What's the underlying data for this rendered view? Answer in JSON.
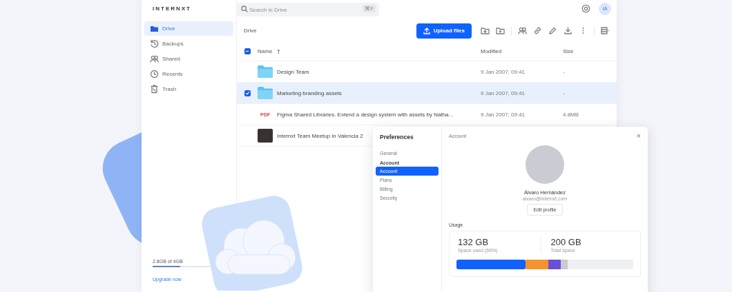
{
  "app": {
    "logo": "INTERNXT",
    "search": {
      "placeholder": "Search in Drive",
      "shortcut": "⌘F"
    },
    "avatar_initials": "IA"
  },
  "sidebar": {
    "items": [
      {
        "label": "Drive",
        "selected": true
      },
      {
        "label": "Backups",
        "selected": false
      },
      {
        "label": "Shared",
        "selected": false
      },
      {
        "label": "Recents",
        "selected": false
      },
      {
        "label": "Trash",
        "selected": false
      }
    ],
    "storage": {
      "text": "2.8GB of 4GB",
      "level": 0.4
    },
    "upgrade": "Upgrade now"
  },
  "toolbar": {
    "breadcrumb": "Drive",
    "upload_button": "Upload files"
  },
  "table": {
    "select_all": {
      "checked": true,
      "partial": true
    },
    "columns": [
      {
        "label": "Name",
        "sorted": true
      },
      {
        "label": "Modified",
        "sorted": false
      },
      {
        "label": "Size",
        "sorted": false
      }
    ],
    "rows": [
      {
        "kind": "folder",
        "name": "Design Team",
        "modified": "9 Jan 2007, 09:41",
        "size": "-",
        "selected": false
      },
      {
        "kind": "folder",
        "name": "Marketing branding assets",
        "modified": "9 Jan 2007, 09:41",
        "size": "-",
        "selected": true
      },
      {
        "kind": "pdf",
        "badge": "PDF",
        "name": "Figma Shared Libraries. Extend a design system with assets by Natha...",
        "modified": "9 Jan 2007, 09:41",
        "size": "4.8MB",
        "selected": false
      },
      {
        "kind": "image",
        "name": "Internxt Team Meetup in Valencia 2",
        "selected": false
      }
    ]
  },
  "preferences": {
    "title": "Preferences",
    "nav": [
      {
        "kind": "item",
        "label": "General",
        "selected": false
      },
      {
        "kind": "heading",
        "label": "Account"
      },
      {
        "kind": "item",
        "label": "Account",
        "selected": true
      },
      {
        "kind": "item",
        "label": "Plans",
        "selected": false
      },
      {
        "kind": "item",
        "label": "Billing",
        "selected": false
      },
      {
        "kind": "item",
        "label": "Security",
        "selected": false
      }
    ],
    "panel_title": "Account",
    "close": "×",
    "profile": {
      "name": "Álvaro Hernández",
      "email": "alvaro@internxt.com",
      "edit_button": "Edit profile"
    },
    "usage": {
      "title": "Usage",
      "stats": [
        {
          "value": "132 GB",
          "label": "Space used (66%)"
        },
        {
          "value": "200 GB",
          "label": "Total space"
        }
      ]
    }
  }
}
